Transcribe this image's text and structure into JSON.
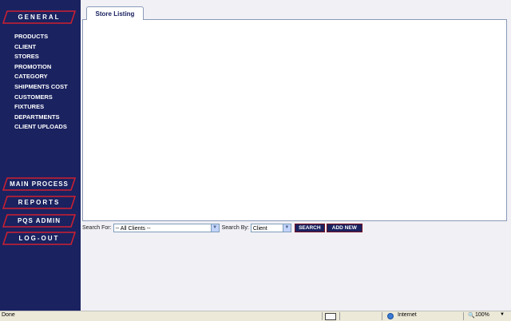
{
  "sidebar": {
    "general_label": "GENERAL",
    "menu": [
      "PRODUCTS",
      "CLIENT",
      "STORES",
      "PROMOTION",
      "CATEGORY",
      "SHIPMENTS COST",
      "CUSTOMERS",
      "FIXTURES",
      "DEPARTMENTS",
      "CLIENT UPLOADS"
    ],
    "main_process_label": "MAIN PROCESS",
    "reports_label": "REPORTS",
    "pqs_admin_label": "PQS ADMIN",
    "logout_label": "LOG-OUT"
  },
  "tab": {
    "label": "Store Listing"
  },
  "search": {
    "search_for_label": "Search For:",
    "search_for_value": "-- All Clients --",
    "search_by_label": "Search By:",
    "search_by_value": "Client",
    "search_button": "SEARCH",
    "add_new_button": "ADD NEW"
  },
  "statusbar": {
    "status": "Done",
    "zone": "Internet",
    "zoom": "100%"
  },
  "colors": {
    "sidebar_bg": "#1a2260",
    "pill_border": "#c0202a",
    "accent": "#1a2260"
  }
}
